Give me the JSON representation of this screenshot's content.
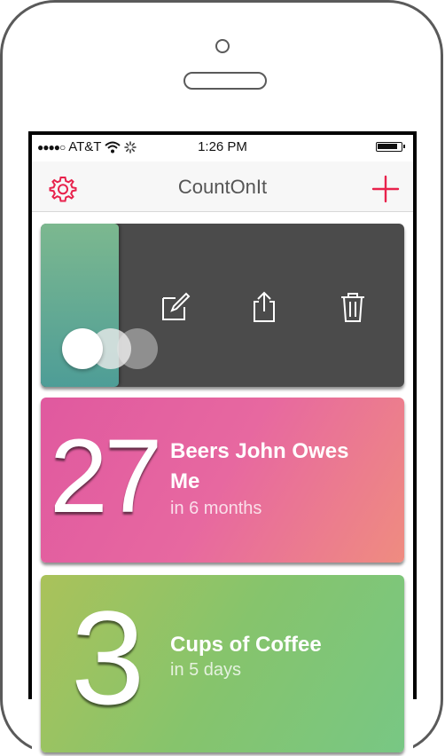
{
  "status_bar": {
    "carrier": "AT&T",
    "time": "1:26 PM"
  },
  "nav": {
    "title": "CountOnIt",
    "settings_icon": "gear-icon",
    "add_icon": "plus-icon"
  },
  "swipe_card": {
    "actions": [
      {
        "icon": "edit-icon"
      },
      {
        "icon": "share-icon"
      },
      {
        "icon": "trash-icon"
      }
    ]
  },
  "counters": [
    {
      "count": "27",
      "title": "Beers John Owes Me",
      "subtitle": "in 6 months"
    },
    {
      "count": "3",
      "title": "Cups of Coffee",
      "subtitle": "in 5 days"
    }
  ],
  "colors": {
    "accent": "#e8224c",
    "pink_start": "#e0599f",
    "pink_end": "#ef8c80",
    "green_start": "#aac25a",
    "green_end": "#78c784",
    "dark_card": "#4b4b4b"
  }
}
